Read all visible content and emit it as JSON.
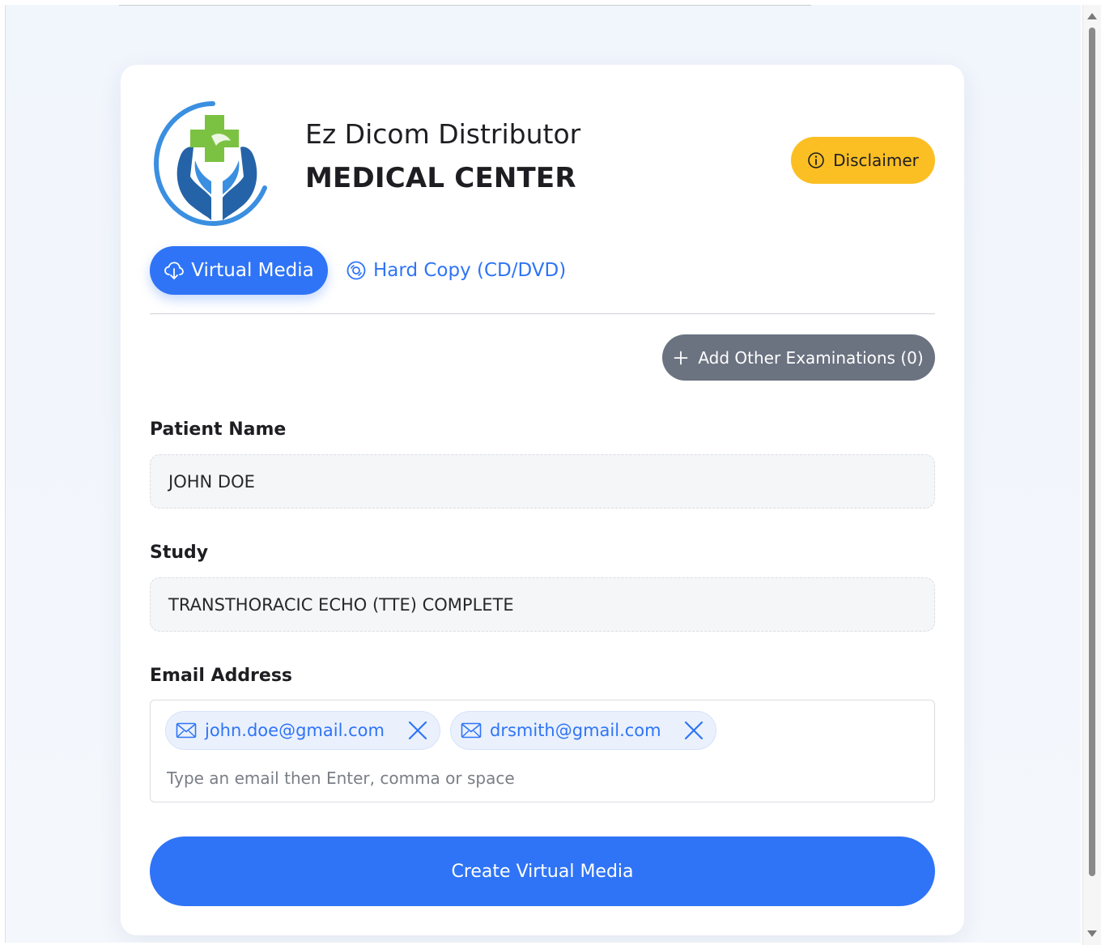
{
  "brand": {
    "title": "Ez Dicom Distributor",
    "subtitle": "MEDICAL CENTER"
  },
  "header": {
    "disclaimer_label": "Disclaimer"
  },
  "tabs": [
    {
      "label": "Virtual Media",
      "active": true,
      "icon": "cloud-download-icon"
    },
    {
      "label": "Hard Copy (CD/DVD)",
      "active": false,
      "icon": "disc-icon"
    }
  ],
  "actions": {
    "add_exam_label": "Add Other Examinations (0)",
    "create_label": "Create Virtual Media"
  },
  "form": {
    "patient_name": {
      "label": "Patient Name",
      "value": "JOHN DOE"
    },
    "study": {
      "label": "Study",
      "value": "TRANSTHORACIC ECHO (TTE) COMPLETE"
    },
    "email": {
      "label": "Email Address",
      "chips": [
        "john.doe@gmail.com",
        "drsmith@gmail.com"
      ],
      "placeholder": "Type an email then Enter, comma or space"
    }
  },
  "colors": {
    "primary": "#2f74f6",
    "warning": "#fbbf24",
    "secondary": "#6b7280",
    "chip_bg": "#eaf1fd",
    "logo_blue": "#2563a8",
    "logo_green": "#7cc242"
  }
}
